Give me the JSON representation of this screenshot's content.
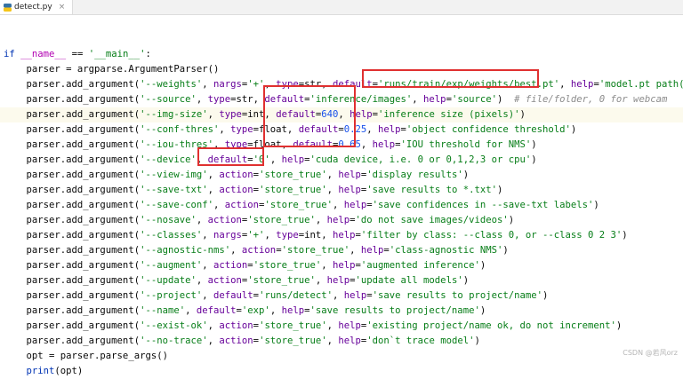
{
  "tab": {
    "filename": "detect.py"
  },
  "code_lines": [
    "",
    "",
    "if __name__ == '__main__':",
    "    parser = argparse.ArgumentParser()",
    "    parser.add_argument('--weights', nargs='+', type=str, default='runs/train/exp/weights/best.pt', help='model.pt path(s)')",
    "    parser.add_argument('--source', type=str, default='inference/images', help='source')  # file/folder, 0 for webcam",
    "    parser.add_argument('--img-size', type=int, default=640, help='inference size (pixels)')",
    "    parser.add_argument('--conf-thres', type=float, default=0.25, help='object confidence threshold')",
    "    parser.add_argument('--iou-thres', type=float, default=0.65, help='IOU threshold for NMS')",
    "    parser.add_argument('--device', default='0', help='cuda device, i.e. 0 or 0,1,2,3 or cpu')",
    "    parser.add_argument('--view-img', action='store_true', help='display results')",
    "    parser.add_argument('--save-txt', action='store_true', help='save results to *.txt')",
    "    parser.add_argument('--save-conf', action='store_true', help='save confidences in --save-txt labels')",
    "    parser.add_argument('--nosave', action='store_true', help='do not save images/videos')",
    "    parser.add_argument('--classes', nargs='+', type=int, help='filter by class: --class 0, or --class 0 2 3')",
    "    parser.add_argument('--agnostic-nms', action='store_true', help='class-agnostic NMS')",
    "    parser.add_argument('--augment', action='store_true', help='augmented inference')",
    "    parser.add_argument('--update', action='store_true', help='update all models')",
    "    parser.add_argument('--project', default='runs/detect', help='save results to project/name')",
    "    parser.add_argument('--name', default='exp', help='save results to project/name')",
    "    parser.add_argument('--exist-ok', action='store_true', help='existing project/name ok, do not increment')",
    "    parser.add_argument('--no-trace', action='store_true', help='don`t trace model')",
    "    opt = parser.parse_args()",
    "    print(opt)"
  ],
  "current_line_index": 6,
  "highlight_lines": [
    4,
    6,
    7,
    8,
    9
  ],
  "watermark": "CSDN @若风orz",
  "colors": {
    "keyword": "#0033b3",
    "string": "#067d17",
    "number": "#1750eb",
    "comment": "#8c8c8c",
    "current_line_bg": "#fcfaed",
    "highlight_box": "#e03030"
  }
}
